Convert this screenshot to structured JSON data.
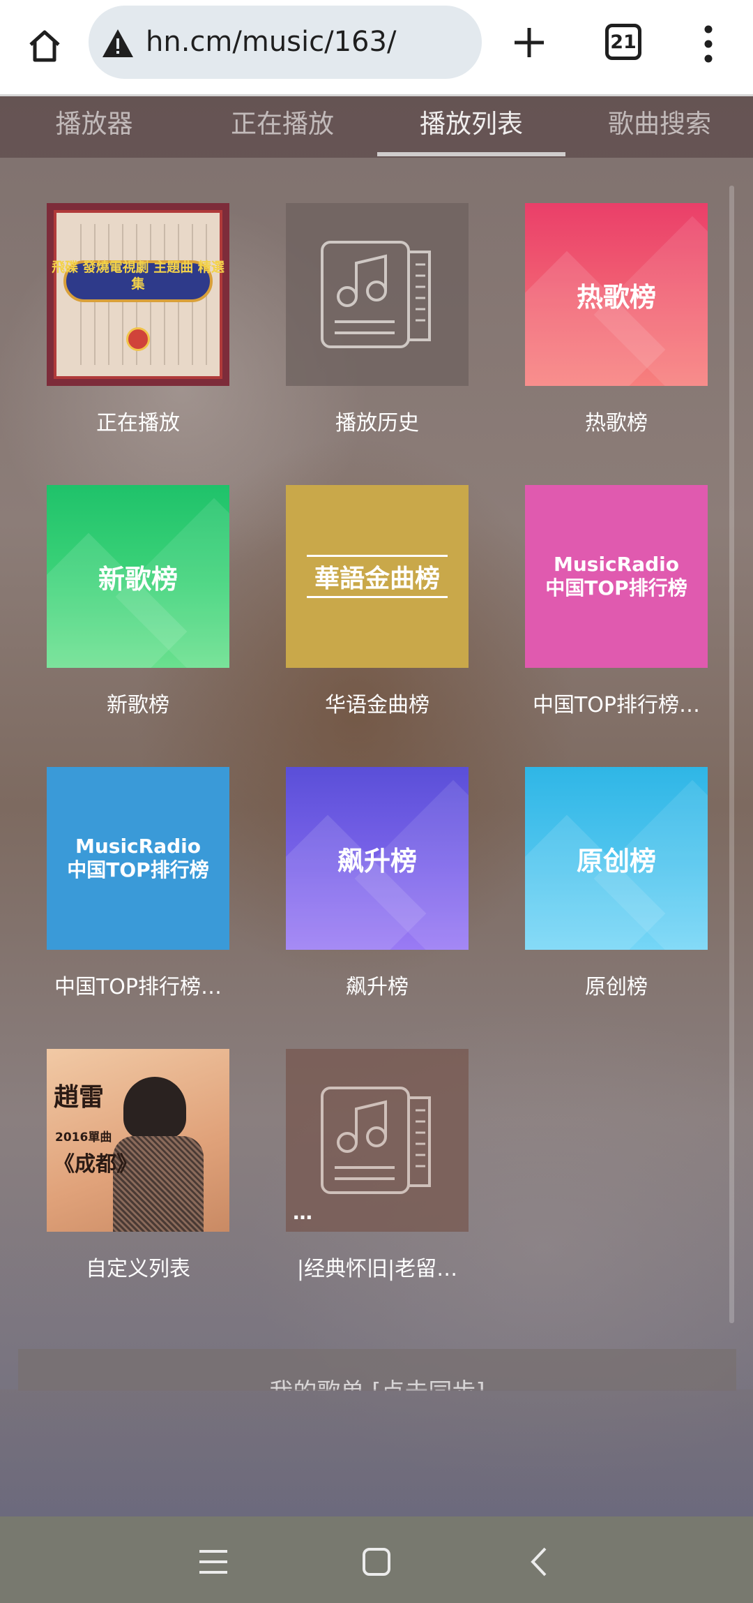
{
  "browser": {
    "url": "hn.cm/music/163/",
    "tab_count": "21"
  },
  "tabs": [
    {
      "label": "播放器"
    },
    {
      "label": "正在播放"
    },
    {
      "label": "播放列表"
    },
    {
      "label": "歌曲搜索"
    }
  ],
  "active_tab_index": 2,
  "playlists": [
    {
      "label": "正在播放",
      "cover_text": "飛碟 發燒電視劇 主題曲 精選集"
    },
    {
      "label": "播放历史"
    },
    {
      "label": "热歌榜",
      "cover_text": "热歌榜"
    },
    {
      "label": "新歌榜",
      "cover_text": "新歌榜"
    },
    {
      "label": "华语金曲榜",
      "cover_text": "華語金曲榜"
    },
    {
      "label": "中国TOP排行榜…",
      "cover_line1": "MusicRadio",
      "cover_line2": "中国TOP排行榜"
    },
    {
      "label": "中国TOP排行榜…",
      "cover_line1": "MusicRadio",
      "cover_line2": "中国TOP排行榜"
    },
    {
      "label": "飙升榜",
      "cover_text": "飙升榜"
    },
    {
      "label": "原创榜",
      "cover_text": "原创榜"
    },
    {
      "label": "自定义列表",
      "cover_line1": "趙雷",
      "cover_line2": "2016單曲",
      "cover_line3": "《成都》"
    },
    {
      "label": "|经典怀旧|老留…",
      "cover_text": "…"
    }
  ],
  "sync_bar": {
    "label": "我的歌单 [点击同步]"
  },
  "player": {
    "progress": 0.0
  }
}
